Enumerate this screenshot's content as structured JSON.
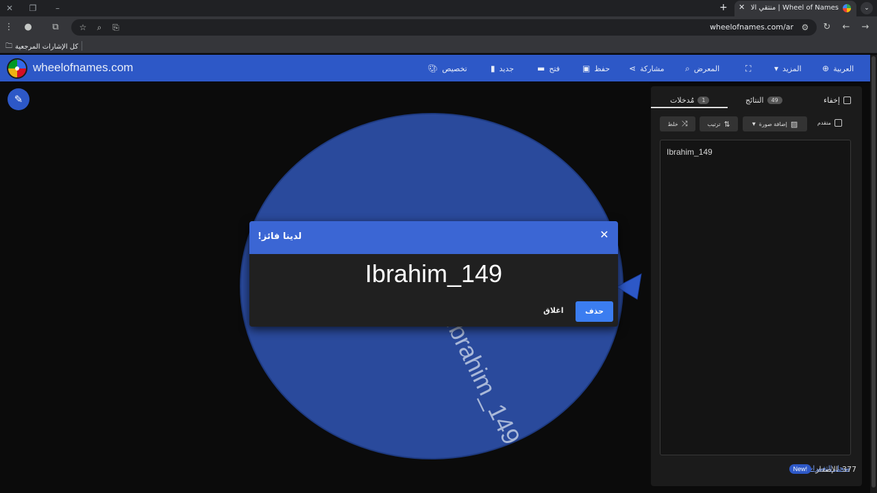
{
  "browser": {
    "tab_title": "Wheel of Names | منتقي الاسم العشوائي",
    "new_tab_icon": "plus-icon",
    "url": "wheelofnames.com/ar",
    "bookmarks_label": "كل الإشارات المرجعية"
  },
  "header": {
    "site_name": "wheelofnames.com",
    "nav": {
      "customize": "تخصيص",
      "new": "جديد",
      "open": "فتح",
      "save": "حفظ",
      "share": "مشاركة",
      "gallery": "المعرض",
      "more": "المزيد",
      "language": "العربية"
    }
  },
  "sidebar": {
    "tab_entries": "مُدخلات",
    "entries_count": "1",
    "tab_results": "النتائج",
    "results_count": "49",
    "hide_label": "إخفاء",
    "shuffle_label": "خلط",
    "sort_label": "ترتيب",
    "add_image_label": "إضافة صورة",
    "advanced_label": "متقدم",
    "entries_text": "Ibrahim_149",
    "new_badge": "New!",
    "version_label": "الإصدار",
    "version_number": "377",
    "changelog_label": "سجل التغييرات"
  },
  "wheel": {
    "segment_label": "Ibrahim_149",
    "segment_color": "#2a4a9c",
    "pointer_color": "#2d58c7"
  },
  "modal": {
    "title": "لدينا فائز!",
    "winner": "Ibrahim_149",
    "close_label": "اغلاق",
    "remove_label": "حذف"
  }
}
